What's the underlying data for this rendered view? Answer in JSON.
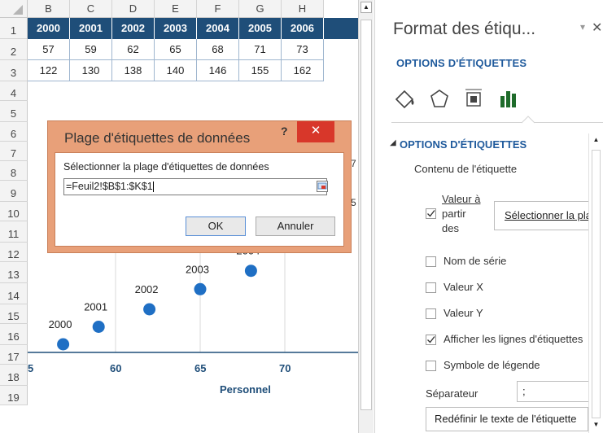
{
  "sheet": {
    "columns": [
      "B",
      "C",
      "D",
      "E",
      "F",
      "G",
      "H"
    ],
    "rows": [
      "1",
      "2",
      "3",
      "4",
      "5",
      "6",
      "7",
      "8",
      "9",
      "10",
      "11",
      "12",
      "13",
      "14",
      "15",
      "16",
      "17",
      "18",
      "19"
    ],
    "years": [
      "2000",
      "2001",
      "2002",
      "2003",
      "2004",
      "2005",
      "2006"
    ],
    "row2": [
      "57",
      "59",
      "62",
      "65",
      "68",
      "71",
      "73"
    ],
    "row3": [
      "122",
      "130",
      "138",
      "140",
      "146",
      "155",
      "162"
    ],
    "header_color": "#1f4e79"
  },
  "chart_data": {
    "type": "scatter",
    "xlabel": "Personnel",
    "x_ticks": [
      "5",
      "60",
      "65",
      "70"
    ],
    "points": [
      {
        "x": 57,
        "label": "2000"
      },
      {
        "x": 59,
        "label": "2001"
      },
      {
        "x": 62,
        "label": "2002"
      },
      {
        "x": 65,
        "label": "2003"
      },
      {
        "x": 68,
        "label": "2004"
      }
    ],
    "marker_color": "#1f6fc4",
    "label_color": "#1f4e79"
  },
  "dialog": {
    "title": "Plage d'étiquettes de données",
    "help": "?",
    "close": "✕",
    "prompt": "Sélectionner la plage d'étiquettes de données",
    "range_value": "=Feuil2!$B$1:$K$1",
    "ok_label": "OK",
    "cancel_label": "Annuler",
    "accent": "#e8a079"
  },
  "pane": {
    "title": "Format des étiqu...",
    "pin": "▾",
    "close": "✕",
    "subtitle": "OPTIONS D'ÉTIQUETTES",
    "section_title": "OPTIONS D'ÉTIQUETTES",
    "section_arrow": "◢",
    "content_label": "Contenu de l'étiquette",
    "valeur_a_line1": "Valeur à",
    "valeur_a_line2": "partir",
    "valeur_a_line3": "des",
    "select_range_label": "Sélectionner la plage",
    "checks": [
      {
        "label": "Nom de série",
        "checked": false
      },
      {
        "label": "Valeur X",
        "checked": false
      },
      {
        "label": "Valeur Y",
        "checked": false
      },
      {
        "label": "Afficher les lignes d'étiquettes",
        "checked": true
      },
      {
        "label": "Symbole de légende",
        "checked": false
      }
    ],
    "separator_label": "Séparateur",
    "separator_value": ";",
    "reset_label": "Redéfinir le texte de l'étiquette",
    "accent": "#1f5a9c"
  },
  "chart_peek": {
    "fragment_7": "7",
    "fragment_5": "5",
    "label_2004_partial": "2004"
  }
}
